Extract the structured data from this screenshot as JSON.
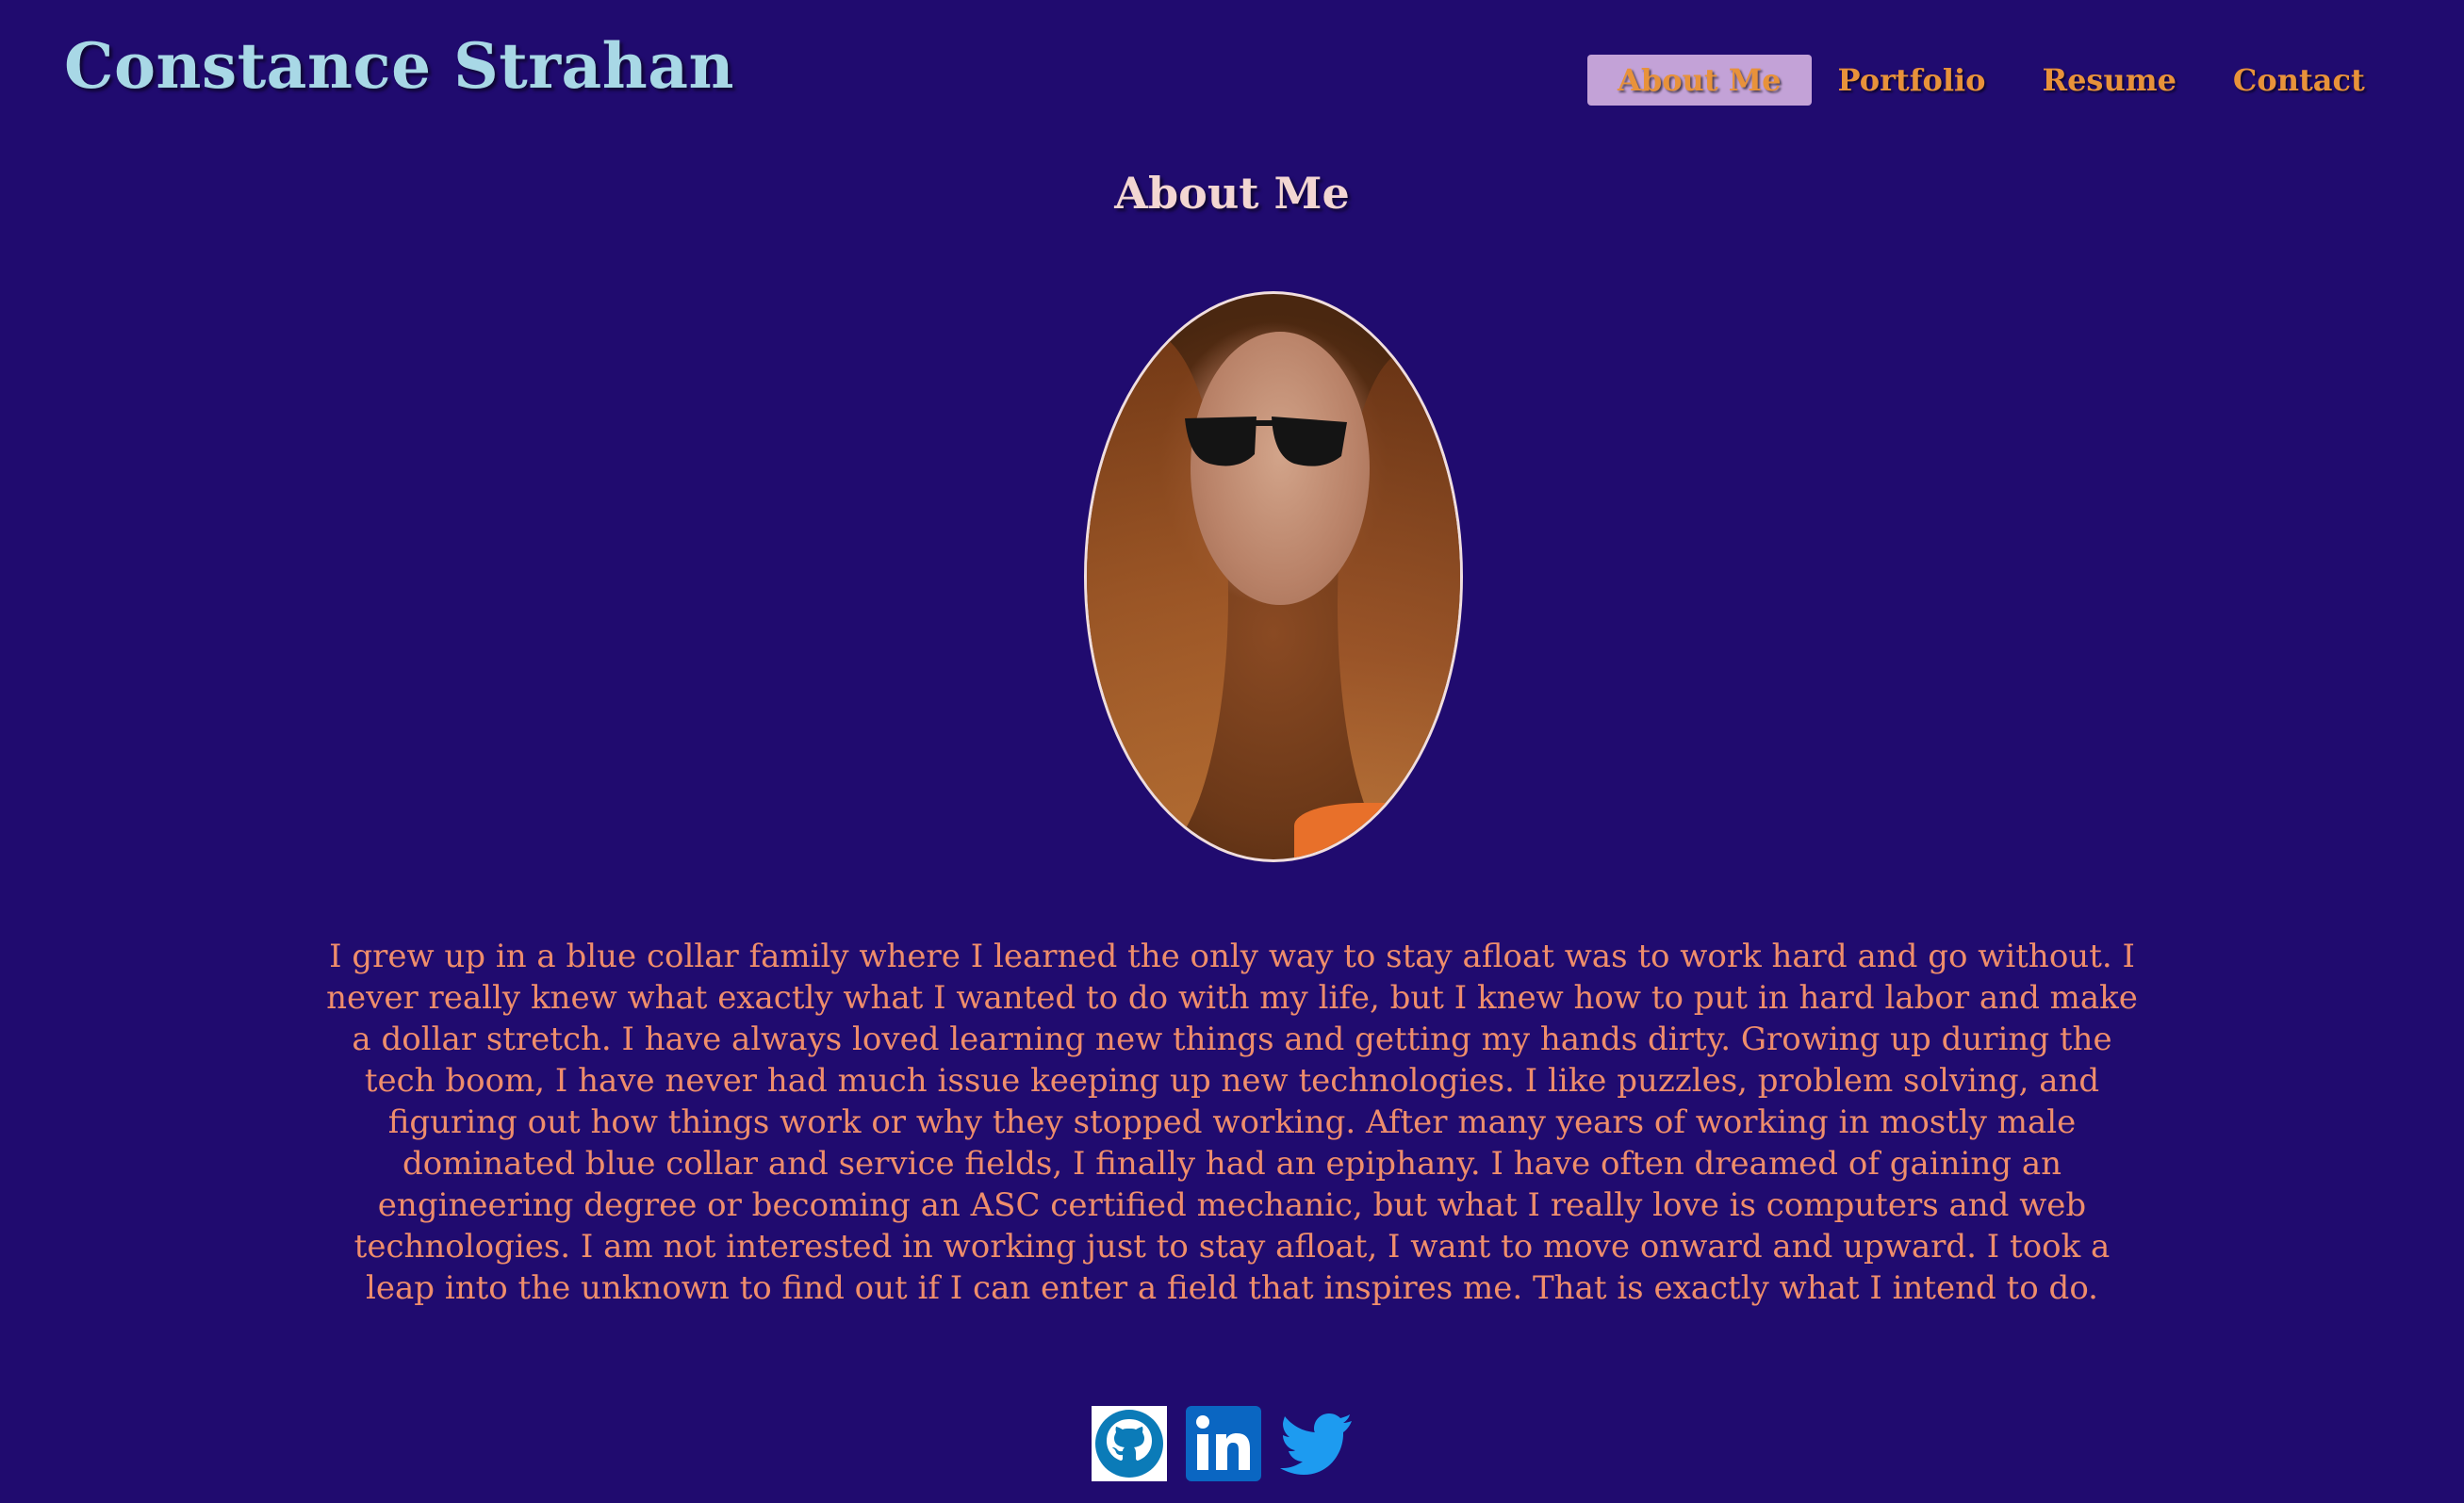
{
  "header": {
    "site_name": "Constance Strahan"
  },
  "nav": {
    "items": [
      {
        "label": "About Me",
        "active": true
      },
      {
        "label": "Portfolio",
        "active": false
      },
      {
        "label": "Resume",
        "active": false
      },
      {
        "label": "Contact",
        "active": false
      }
    ]
  },
  "main": {
    "title": "About Me",
    "bio": "I grew up in a blue collar family where I learned the only way to stay afloat was to work hard and go without. I never really knew what exactly what I wanted to do with my life, but I knew how to put in hard labor and make a dollar stretch. I have always loved learning new things and getting my hands dirty. Growing up during the tech boom, I have never had much issue keeping up new technologies. I like puzzles, problem solving, and figuring out how things work or why they stopped working. After many years of working in mostly male dominated blue collar and service fields, I finally had an epiphany. I have often dreamed of gaining an engineering degree or becoming an ASC certified mechanic, but what I really love is computers and web technologies. I am not interested in working just to stay afloat, I want to move onward and upward. I took a leap into the unknown to find out if I can enter a field that inspires me. That is exactly what I intend to do."
  },
  "socials": {
    "icons": [
      "github-icon",
      "linkedin-icon",
      "twitter-icon"
    ]
  },
  "colors": {
    "background": "#200b6f",
    "site_name": "#a8d8e6",
    "nav_text": "#e8923a",
    "nav_active_bg": "#c3a2d7",
    "title": "#f3d6d2",
    "bio_text": "#ef8d6b",
    "github_blue": "#0b7bb8",
    "linkedin_blue": "#0a66c2",
    "twitter_blue": "#1d9bf0"
  }
}
